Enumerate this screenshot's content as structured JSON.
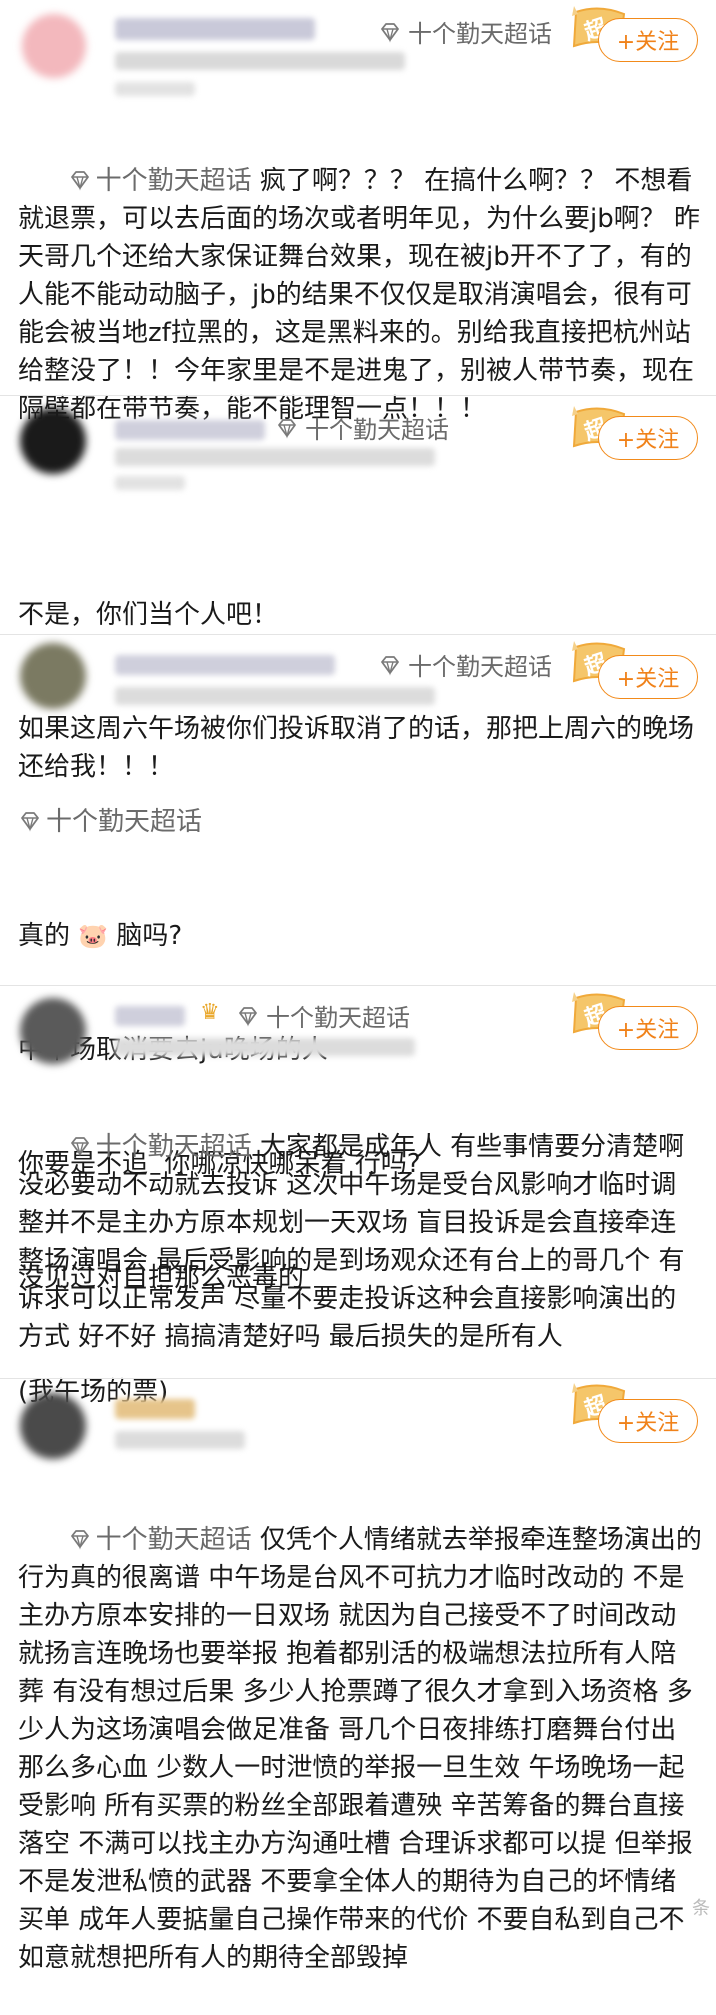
{
  "supertopic_label": "十个勤天超话",
  "follow_label": "+关注",
  "badge_label": "超",
  "posts": [
    {
      "body": "疯了啊？？？ 在搞什么啊？？ 不想看就退票，可以去后面的场次或者明年见，为什么要jb啊？ 昨天哥几个还给大家保证舞台效果，现在被jb开不了了，有的人能不能动动脑子，jb的结果不仅仅是取消演唱会，很有可能会被当地zf拉黑的，这是黑料来的。别给我直接把杭州站给整没了！！今年家里是不是进鬼了，别被人带节奏，现在隔壁都在带节奏，能不能理智一点！！！"
    },
    {
      "body_lines": [
        "不是，你们当个人吧！",
        "如果这周六午场被你们投诉取消了的话，那把上周六的晚场还给我！！！"
      ]
    },
    {
      "line1_prefix": "真的 ",
      "line1_emoji": "🐷",
      "line1_suffix": " 脑吗?",
      "lines": [
        "中午场取消要去ju晚场的人",
        "你要是不追  你哪凉快哪呆着 行吗?",
        "没见过对自担那么恶毒的",
        "(我午场的票)"
      ]
    },
    {
      "body": "大家都是成年人 有些事情要分清楚啊 没必要动不动就去投诉 这次中午场是受台风影响才临时调整并不是主办方原本规划一天双场 盲目投诉是会直接牵连整场演唱会 最后受影响的是到场观众还有台上的哥几个 有诉求可以正常发声 尽量不要走投诉这种会直接影响演出的方式 好不好 搞搞清楚好吗 最后损失的是所有人"
    },
    {
      "body": "仅凭个人情绪就去举报牵连整场演出的行为真的很离谱 中午场是台风不可抗力才临时改动的 不是主办方原本安排的一日双场 就因为自己接受不了时间改动 就扬言连晚场也要举报 抱着都别活的极端想法拉所有人陪葬 有没有想过后果 多少人抢票蹲了很久才拿到入场资格 多少人为这场演唱会做足准备 哥几个日夜排练打磨舞台付出那么多心血 少数人一时泄愤的举报一旦生效 午场晚场一起受影响 所有买票的粉丝全部跟着遭殃 辛苦筹备的舞台直接落空 不满可以找主办方沟通吐槽 合理诉求都可以提 但举报不是发泄私愤的武器 不要拿全体人的期待为自己的坏情绪买单 成年人要掂量自己操作带来的代价 不要自私到自己不如意就想把所有人的期待全部毁掉"
    }
  ],
  "watermark": "条"
}
